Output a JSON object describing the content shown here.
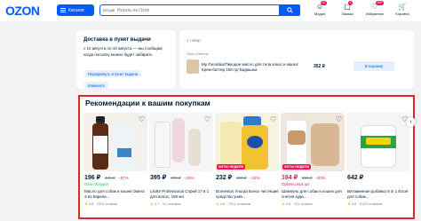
{
  "header": {
    "logo": "OZON",
    "catalog_label": "Каталог",
    "search": {
      "scope": "Везде",
      "placeholder": "Искать на Ozon"
    },
    "nav": [
      {
        "label": "Модия",
        "badge": "10",
        "icon": "user-icon"
      },
      {
        "label": "Заказы",
        "badge": "1",
        "icon": "box-icon"
      },
      {
        "label": "Избранное",
        "badge": "99+",
        "icon": "heart-icon"
      },
      {
        "label": "Корзина",
        "badge": "",
        "icon": "cart-icon"
      }
    ]
  },
  "delivery": {
    "title": "Доставка в пункт выдачи",
    "text": "с 10 августа по 10 августа — мы сообщим, когда посылку можно будет забирать",
    "link1": "Передвинуть в пункт выдачи",
    "link2": "Изменить"
  },
  "cart": {
    "count": "1 товар",
    "seller": "Ozon Generic",
    "item_name": "My Geomiko/Пикодое масло для тела кокос и какао/Крем-баттер 150 гр/ Бадюшка",
    "price": "352 ₽",
    "button": "В корзину"
  },
  "recommendations": {
    "title": "Рекомендации к вашим покупкам",
    "products": [
      {
        "price": "196 ₽",
        "old": "449 ₽",
        "discount": "−57%",
        "seller": "Ozon Хотдол",
        "name": "Масло для собак и кошек Омега 3 из Карели...",
        "rating": "4.8 · 1324 отзыва",
        "hit": ""
      },
      {
        "price": "395 ₽",
        "old": "470 ₽",
        "discount": "−16%",
        "seller": "",
        "name": "Lilotte Professional Спрей 17 в 1 для волос, 150 мл",
        "rating": "4.7 · 12 отзывов",
        "hit": ""
      },
      {
        "price": "232 ₽",
        "old": "400 ₽",
        "discount": "−42%",
        "seller": "",
        "name": "Domestos Ультра Блеск чистящее средство унив...",
        "rating": "4.8 · 7312 отзывов",
        "hit": "ХИТЫ НЕДЕЛИ"
      },
      {
        "price": "164 ₽",
        "old": "350 ₽",
        "discount": "−53%",
        "seller": "Oplomu 814 шт",
        "name": "Шампунь для собак и кошек для снятия зуда...",
        "rating": "4.6 · 123 отзыва",
        "hit": "ХИТЫ НЕДЕЛИ"
      },
      {
        "price": "642 ₽",
        "old": "",
        "discount": "",
        "seller": "",
        "name": "Витаминная добавка 8 in 1 Excel для собак...",
        "rating": "4.8 · 6123 отзывов",
        "hit": ""
      }
    ]
  }
}
